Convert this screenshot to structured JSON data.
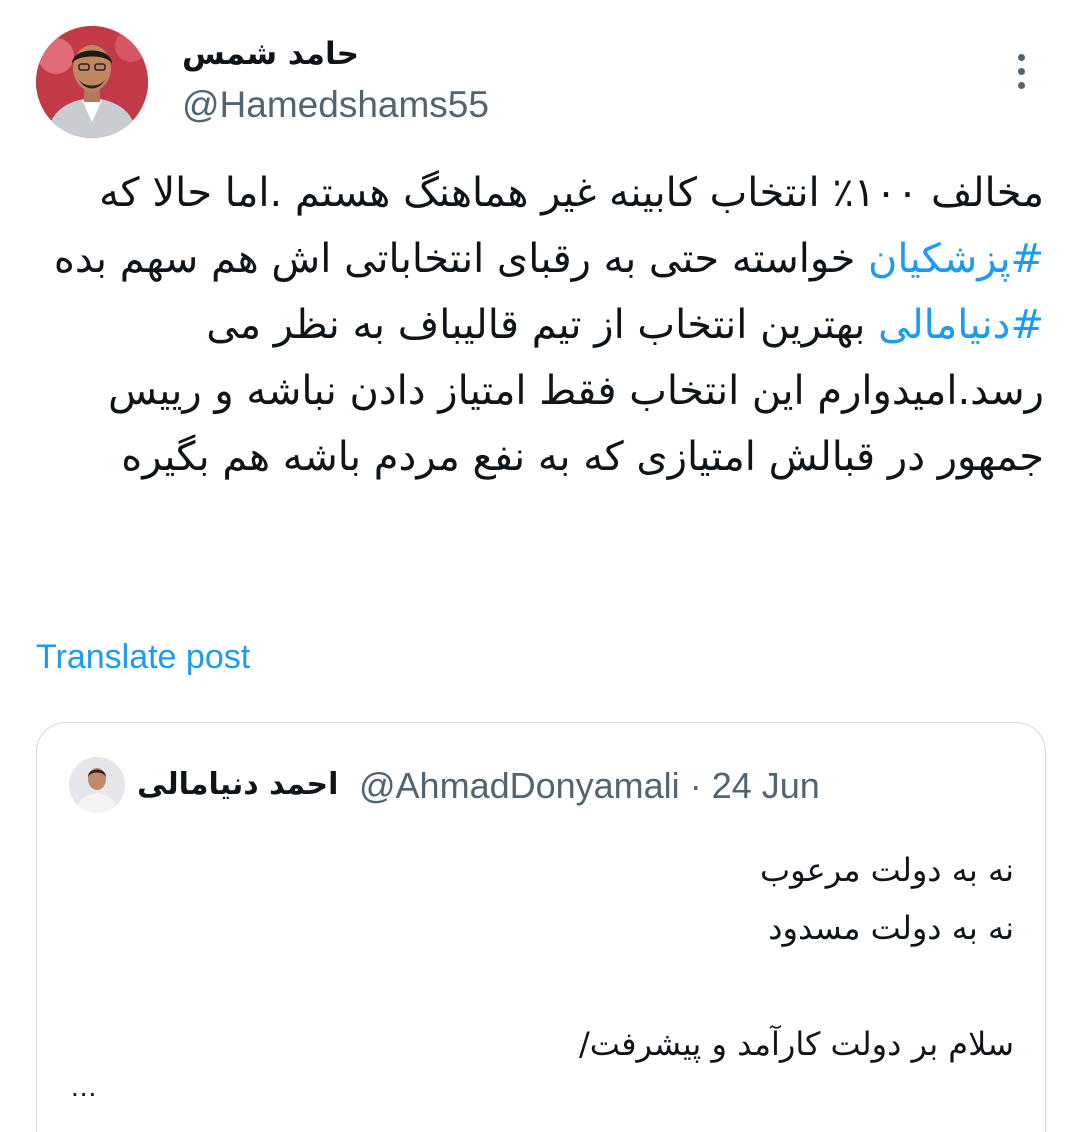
{
  "post": {
    "author": {
      "name": "حامد شمس",
      "handle": "@Hamedshams55"
    },
    "more_icon": "more-vertical-icon",
    "text": {
      "part1": "مخالف ۱۰۰٪ انتخاب کابینه غیر هماهنگ هستم .اما حالا که ",
      "hashtag1": "#پزشکیان",
      "part2": " خواسته حتی به رقبای انتخاباتی اش هم سهم بده ",
      "hashtag2": "#دنیامالی",
      "part3": " بهترین انتخاب از تیم قالیباف به نظر می رسد.امیدوارم این انتخاب فقط امتیاز دادن نباشه و رییس جمهور در قبالش امتیازی که به نفع مردم باشه هم بگیره"
    },
    "translate_label": "Translate post"
  },
  "quote": {
    "name": "احمد دنیامالی",
    "handle": "@AhmadDonyamali",
    "separator": "·",
    "date": "24 Jun",
    "lines": [
      "نه به دولت مرعوب",
      "نه به دولت مسدود",
      "",
      "سلام بر دولت کارآمد و پیشرفت/"
    ],
    "ellipsis": "..."
  },
  "colors": {
    "link": "#1d9bf0",
    "secondary_text": "#536471",
    "border": "#cfd9de"
  }
}
